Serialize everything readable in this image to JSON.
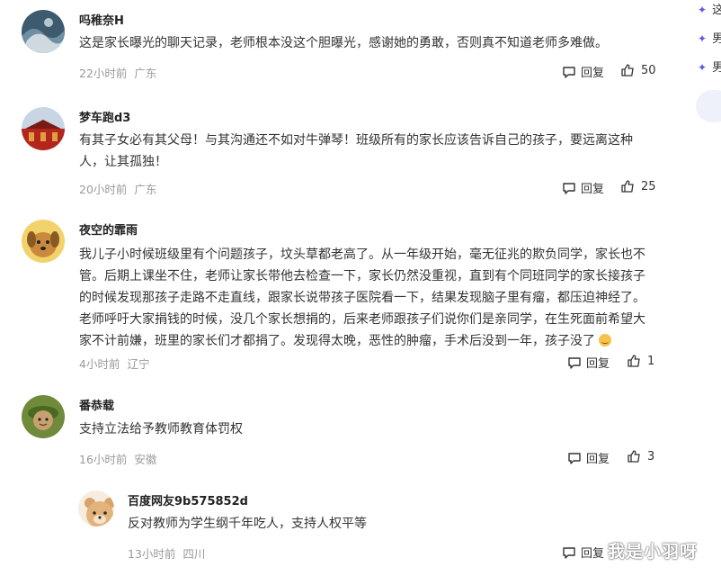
{
  "comments": [
    {
      "user": "吗稚奈H",
      "text": "这是家长曝光的聊天记录，老师根本没这个胆曝光，感谢她的勇敢，否则真不知道老师多难做。",
      "time": "22小时前",
      "location": "广东",
      "reply_label": "回复",
      "likes": "50",
      "avatar_icon": "sea-wave-avatar"
    },
    {
      "user": "梦车跑d3",
      "text_lines": [
        "有其子女必有其父母！与其沟通还不如对牛弹琴！班级所有的家长应该告诉自己的孩子，要远离这种",
        "人，让其孤独！"
      ],
      "time": "20小时前",
      "location": "广东",
      "reply_label": "回复",
      "likes": "25",
      "avatar_icon": "red-building-avatar"
    },
    {
      "user": "夜空的霏雨",
      "text_lines": [
        "我儿子小时候班级里有个问题孩子，坟头草都老高了。从一年级开始，毫无征兆的欺负同学，家长也不",
        "管。后期上课坐不住，老师让家长带他去检查一下，家长仍然没重视，直到有个同班同学的家长接孩子",
        "的时候发现那孩子走路不走直线，跟家长说带孩子医院看一下，结果发现脑子里有瘤，都压迫神经了。",
        "老师呼吁大家捐钱的时候，没几个家长想捐的，后来老师跟孩子们说你们是亲同学，在生死面前希望大",
        "家不计前嫌，班里的家长们才都捐了。发现得太晚，恶性的肿瘤，手术后没到一年，孩子没了"
      ],
      "time": "4小时前",
      "location": "辽宁",
      "reply_label": "回复",
      "likes": "1",
      "avatar_icon": "dog-avatar"
    },
    {
      "user": "番恭载",
      "text": "支持立法给予教师教育体罚权",
      "time": "16小时前",
      "location": "安徽",
      "reply_label": "回复",
      "likes": "3",
      "avatar_icon": "cartoon-character-avatar"
    }
  ],
  "reply": {
    "user": "百度网友9b575852d",
    "text": "反对教师为学生纲千年吃人，支持人权平等",
    "time": "13小时前",
    "location": "四川",
    "reply_label": "回复",
    "avatar_icon": "bear-avatar"
  },
  "sidebar": {
    "items": [
      "这",
      "男",
      "男"
    ],
    "bullet_icon": "sparkle-icon",
    "accent": "#5a5af0"
  },
  "watermark": "我是小羽呀"
}
